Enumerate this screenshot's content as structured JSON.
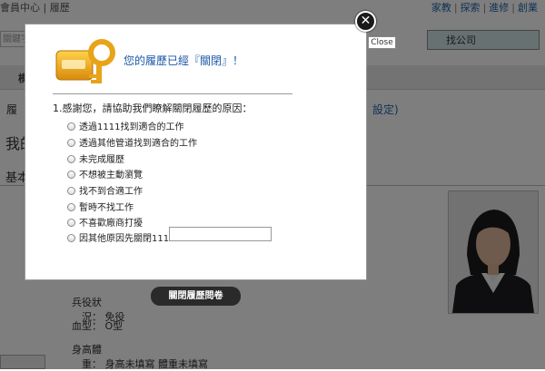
{
  "breadcrumb": {
    "prefix": "會員中心",
    "separator": "|",
    "current": "履歷"
  },
  "top_links": [
    "家教",
    "探索",
    "進修",
    "創業"
  ],
  "top_link_sep": "|",
  "background": {
    "keyword_placeholder": "關鍵字",
    "company_button": "找公司",
    "tab_label": "模",
    "fragment_left": "履",
    "fragment_right": "設定)",
    "fragment_name": "我的",
    "section_title": "基本",
    "info": [
      {
        "label": "兵役狀況：",
        "value": "免役"
      },
      {
        "label": "血型：",
        "value": "O型"
      },
      {
        "label": "身高體重：",
        "value": "身高未填寫 體重未填寫"
      }
    ]
  },
  "modal": {
    "title": "您的履歷已經『關閉』！",
    "question": "1.感謝您，請協助我們瞭解關閉履歷的原因：",
    "options": [
      "透過1111找到適合的工作",
      "透過其他管道找到適合的工作",
      "未完成履歷",
      "不想被主動瀏覽",
      "找不到合適工作",
      "暫時不找工作",
      "不喜歡廠商打擾",
      "因其他原因先關閉1111"
    ],
    "other_input_value": "",
    "close_symbol": "✕",
    "close_tooltip": "Close"
  },
  "survey_button": "關閉履歷問卷",
  "colors": {
    "title_blue": "#1a57a8",
    "key_gold": "#e8a318",
    "overlay": "rgba(0,0,0,0.5)"
  }
}
